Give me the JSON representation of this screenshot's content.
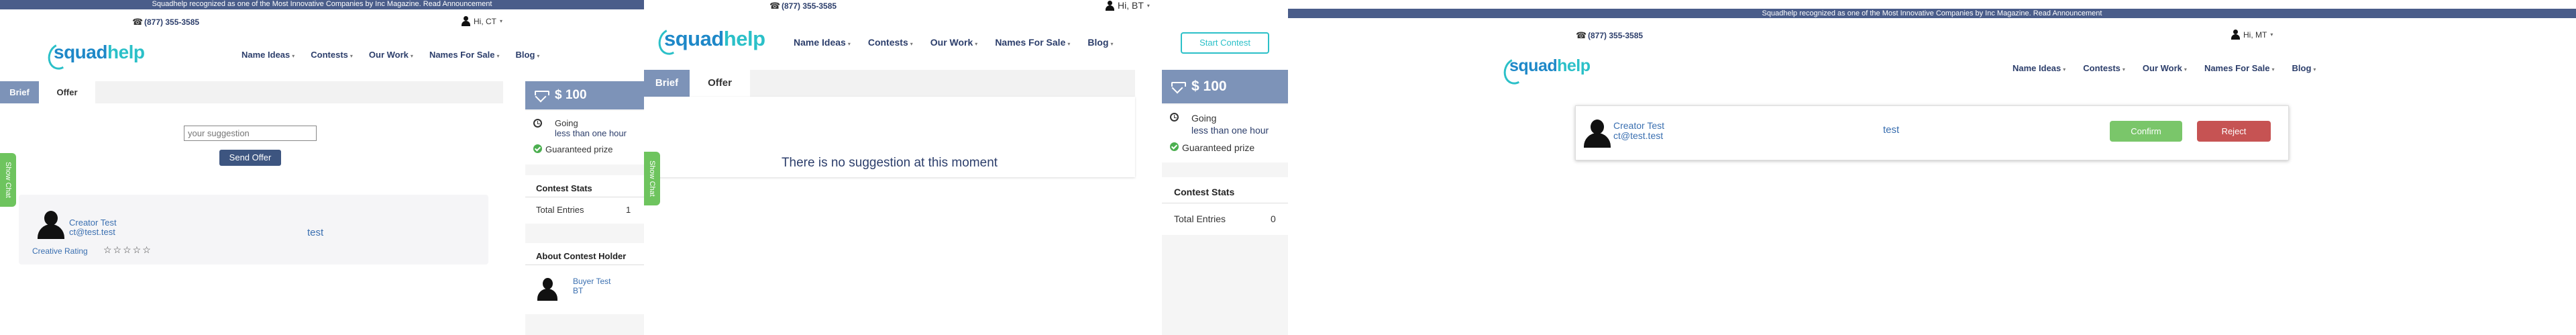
{
  "announcement": "Squadhelp recognized as one of the Most Innovative Companies by Inc Magazine. Read Announcement",
  "phone": "(877) 355-3585",
  "logo": {
    "part1": "squad",
    "part2": "help"
  },
  "nav": [
    "Name Ideas",
    "Contests",
    "Our Work",
    "Names For Sale",
    "Blog"
  ],
  "start_contest": "Start Contest",
  "tabs": {
    "brief": "Brief",
    "offer": "Offer"
  },
  "show_chat": "Show Chat",
  "panel1": {
    "user_greeting": "Hi, CT",
    "suggestion_placeholder": "your suggestion",
    "send_offer": "Send Offer",
    "entry": {
      "name": "Creator Test",
      "email": "ct@test.test",
      "offer_text": "test",
      "rating_label": "Creative Rating",
      "stars": "☆☆☆☆☆"
    },
    "prize": "$ 100",
    "status": "Going",
    "time_left": "less than one hour",
    "guaranteed": "Guaranteed prize",
    "stats_title": "Contest Stats",
    "total_entries_label": "Total Entries",
    "total_entries": "1",
    "holder_title": "About Contest Holder",
    "holder_name": "Buyer Test",
    "holder_initials": "BT"
  },
  "panel2": {
    "user_greeting": "Hi, BT",
    "empty_message": "There is no suggestion at this moment",
    "prize": "$ 100",
    "status": "Going",
    "time_left": "less than one hour",
    "guaranteed": "Guaranteed prize",
    "stats_title": "Contest Stats",
    "total_entries_label": "Total Entries",
    "total_entries": "0"
  },
  "panel3": {
    "user_greeting": "Hi, MT",
    "creator_name": "Creator Test",
    "creator_email": "ct@test.test",
    "offer_text": "test",
    "confirm": "Confirm",
    "reject": "Reject"
  },
  "colors": {
    "brand_blue": "#1e88c8",
    "brand_teal": "#2bc0c8",
    "navy": "#2c3e6b",
    "tab_active": "#7d93b8",
    "chat_green": "#6ec45e",
    "confirm_green": "#7ac66a",
    "reject_red": "#c65353"
  }
}
